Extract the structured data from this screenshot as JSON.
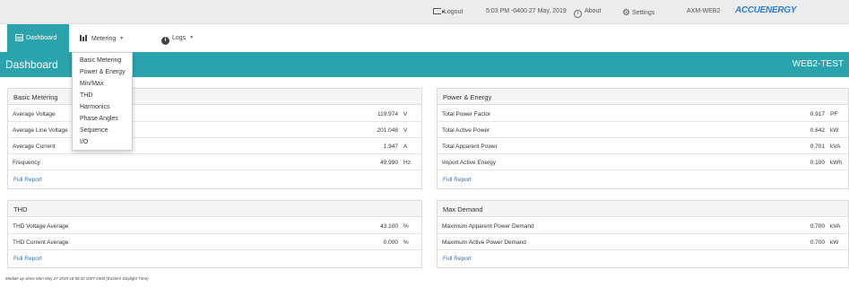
{
  "topbar": {
    "logout": "Logout",
    "clock": "5:03 PM -0400 27 May, 2019",
    "about": "About",
    "settings": "Settings",
    "hostname": "AXM-WEB2",
    "brand": "ACCUENERGY"
  },
  "nav": {
    "dashboard": "Dashboard",
    "metering": "Metering",
    "logs": "Logs"
  },
  "header": {
    "title": "Dashboard",
    "device": "WEB2-TEST"
  },
  "metering_menu": [
    "Basic Metering",
    "Power & Energy",
    "Min/Max",
    "THD",
    "Harmonics",
    "Phase Angles",
    "Sequence",
    "I/O"
  ],
  "panels": {
    "basic": {
      "title": "Basic Metering",
      "rows": [
        {
          "label": "Average Voltage",
          "value": "119.974",
          "unit": "V"
        },
        {
          "label": "Average Line Voltage",
          "value": "201.048",
          "unit": "V"
        },
        {
          "label": "Average Current",
          "value": "1.947",
          "unit": "A"
        },
        {
          "label": "Frequency",
          "value": "49.990",
          "unit": "Hz"
        }
      ],
      "link": "Full Report"
    },
    "power": {
      "title": "Power & Energy",
      "rows": [
        {
          "label": "Total Power Factor",
          "value": "0.917",
          "unit": "PF"
        },
        {
          "label": "Total Active Power",
          "value": "0.642",
          "unit": "kW"
        },
        {
          "label": "Total Apparent Power",
          "value": "0.701",
          "unit": "kVA"
        },
        {
          "label": "Import Active Energy",
          "value": "0.100",
          "unit": "kWh"
        }
      ],
      "link": "Full Report"
    },
    "thd": {
      "title": "THD",
      "rows": [
        {
          "label": "THD Voltage Average",
          "value": "43.100",
          "unit": "%"
        },
        {
          "label": "THD Current Average",
          "value": "0.000",
          "unit": "%"
        }
      ],
      "link": "Full Report"
    },
    "maxd": {
      "title": "Max Demand",
      "rows": [
        {
          "label": "Maximum Apparent Power Demand",
          "value": "0.700",
          "unit": "kVA"
        },
        {
          "label": "Maximum Active Power Demand",
          "value": "0.700",
          "unit": "kW"
        }
      ],
      "link": "Full Report"
    }
  },
  "footer": "Module up since Mon May 27 2019 16:56:42 GMT-0400 (Eastern Daylight Time)"
}
